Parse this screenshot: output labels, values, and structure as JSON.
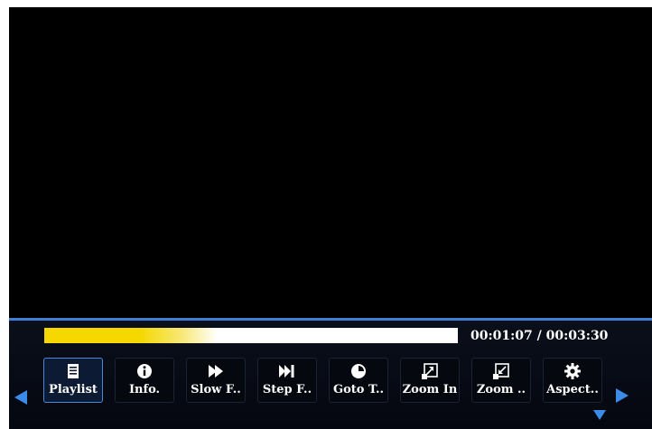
{
  "player": {
    "time_display": "00:01:07 / 00:03:30",
    "progress_fraction": 0.42,
    "colors": {
      "accent": "#3f7fd6",
      "progress_fill": "#f4d800",
      "progress_track": "#ffffff",
      "background": "#000000"
    }
  },
  "toolbar": {
    "items": [
      {
        "label": "Playlist",
        "icon": "playlist-icon"
      },
      {
        "label": "Info.",
        "icon": "info-icon"
      },
      {
        "label": "Slow F..",
        "icon": "slow-forward-icon"
      },
      {
        "label": "Step F..",
        "icon": "step-forward-icon"
      },
      {
        "label": "Goto T..",
        "icon": "clock-icon"
      },
      {
        "label": "Zoom In",
        "icon": "zoom-in-icon"
      },
      {
        "label": "Zoom ..",
        "icon": "zoom-out-icon"
      },
      {
        "label": "Aspect..",
        "icon": "gear-icon"
      }
    ],
    "selected_index": 0
  },
  "navigation": {
    "left": "left-arrow-icon",
    "right": "right-arrow-icon",
    "down": "down-arrow-icon"
  }
}
